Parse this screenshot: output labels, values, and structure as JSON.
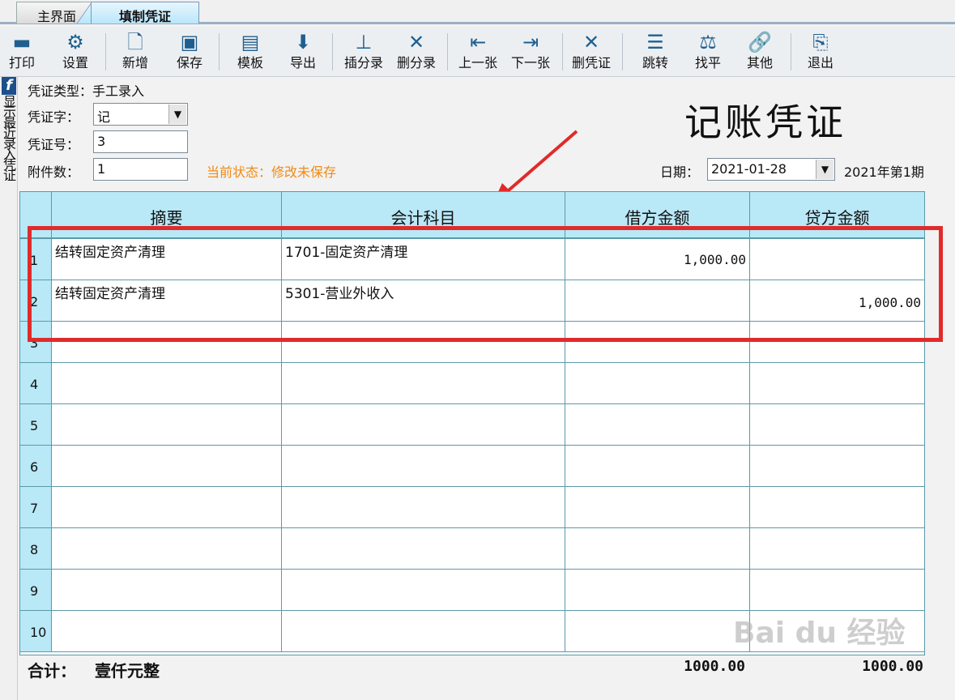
{
  "tabs": {
    "home": "主界面",
    "active": "填制凭证"
  },
  "toolbar": {
    "print": "打印",
    "settings": "设置",
    "new": "新增",
    "save": "保存",
    "template": "模板",
    "export": "导出",
    "insert_entry": "插分录",
    "delete_entry": "删分录",
    "prev": "上一张",
    "next": "下一张",
    "delete_voucher": "删凭证",
    "jump": "跳转",
    "balance": "找平",
    "other": "其他",
    "exit": "退出"
  },
  "side": {
    "text": "显示最近录入凭证"
  },
  "header": {
    "type_label": "凭证类型：",
    "type_value": "手工录入",
    "word_label": "凭证字：",
    "word_value": "记",
    "number_label": "凭证号：",
    "number_value": "3",
    "attach_label": "附件数：",
    "attach_value": "1",
    "status": "当前状态：修改未保存",
    "title": "记账凭证",
    "date_label": "日期：",
    "date_value": "2021-01-28",
    "period": "2021年第1期"
  },
  "grid": {
    "columns": [
      "摘要",
      "会计科目",
      "借方金额",
      "贷方金额"
    ],
    "rows": [
      {
        "no": "1",
        "summary": "结转固定资产清理",
        "account": "1701-固定资产清理",
        "debit": "1,000.00",
        "credit": ""
      },
      {
        "no": "2",
        "summary": "结转固定资产清理",
        "account": "5301-营业外收入",
        "debit": "",
        "credit": "1,000.00"
      },
      {
        "no": "3",
        "summary": "",
        "account": "",
        "debit": "",
        "credit": ""
      },
      {
        "no": "4",
        "summary": "",
        "account": "",
        "debit": "",
        "credit": ""
      },
      {
        "no": "5",
        "summary": "",
        "account": "",
        "debit": "",
        "credit": ""
      },
      {
        "no": "6",
        "summary": "",
        "account": "",
        "debit": "",
        "credit": ""
      },
      {
        "no": "7",
        "summary": "",
        "account": "",
        "debit": "",
        "credit": ""
      },
      {
        "no": "8",
        "summary": "",
        "account": "",
        "debit": "",
        "credit": ""
      },
      {
        "no": "9",
        "summary": "",
        "account": "",
        "debit": "",
        "credit": ""
      },
      {
        "no": "10",
        "summary": "",
        "account": "",
        "debit": "",
        "credit": ""
      }
    ]
  },
  "totals": {
    "label": "合计：",
    "words": "壹仟元整",
    "debit": "1000.00",
    "credit": "1000.00"
  },
  "watermark": "Bai du 经验",
  "colors": {
    "header_bg": "#b9e8f7",
    "grid_line": "#5c9aa8",
    "status": "#f08a14",
    "highlight": "#e02b2b"
  }
}
